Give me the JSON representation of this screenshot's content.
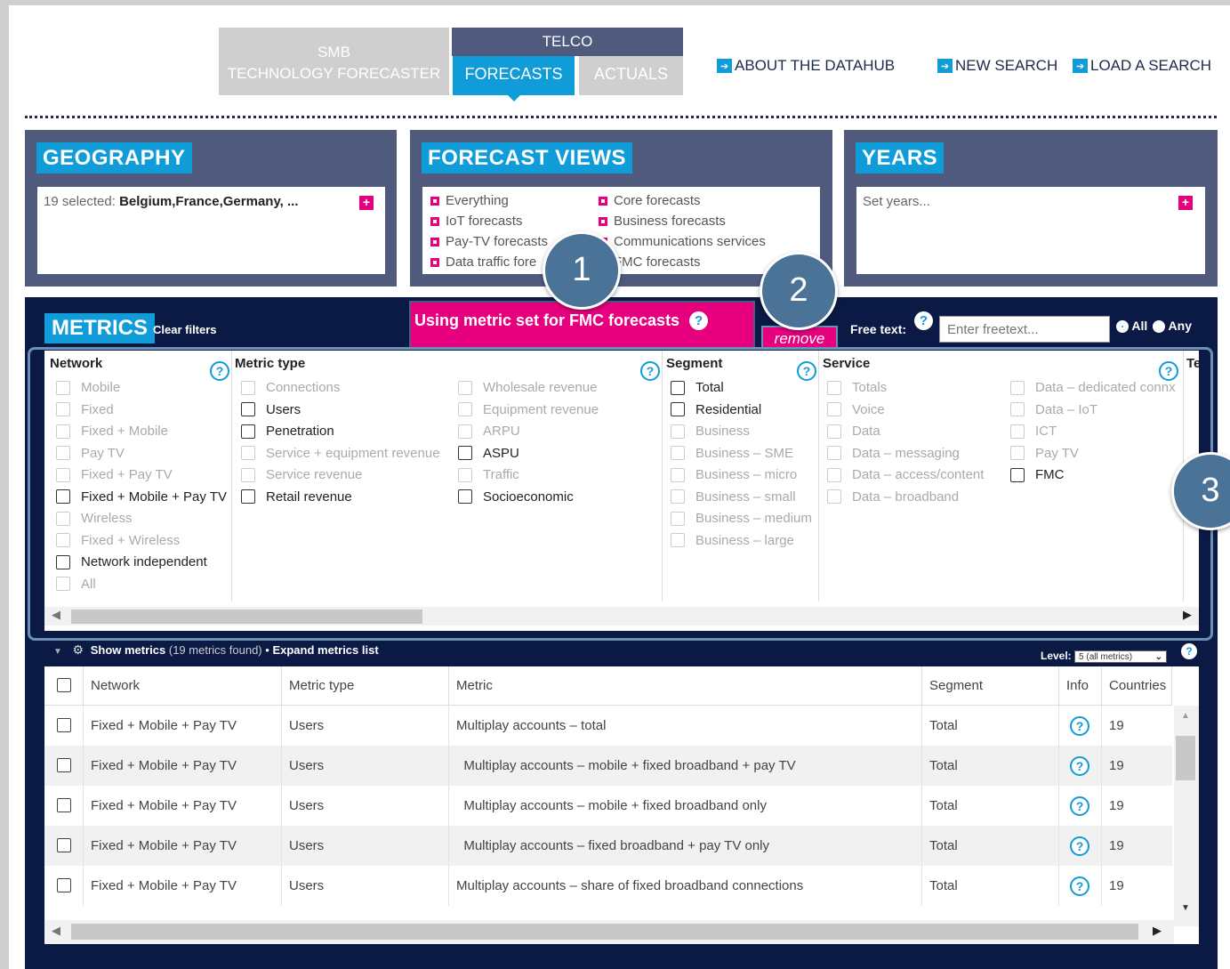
{
  "top_tabs": {
    "smb_line1": "SMB",
    "smb_line2": "TECHNOLOGY FORECASTER",
    "telco": "TELCO",
    "forecasts": "FORECASTS",
    "actuals": "ACTUALS"
  },
  "top_links": {
    "about": "ABOUT THE DATAHUB",
    "new_search": "NEW SEARCH",
    "load_search": "LOAD A SEARCH"
  },
  "geography": {
    "title": "GEOGRAPHY",
    "selected_prefix": "19 selected:",
    "selected_values": "Belgium,France,Germany, ..."
  },
  "forecast_views": {
    "title": "FORECAST VIEWS",
    "left": [
      "Everything",
      "IoT forecasts",
      "Pay-TV forecasts",
      "Data traffic fore"
    ],
    "right": [
      "Core forecasts",
      "Business forecasts",
      "Communications services",
      "FMC forecasts"
    ]
  },
  "years": {
    "title": "YEARS",
    "placeholder": "Set years..."
  },
  "metrics": {
    "title": "METRICS",
    "clear_filters": "Clear filters",
    "metric_set": "Using metric set for FMC forecasts",
    "remove": "remove",
    "free_text_label": "Free text:",
    "free_text_placeholder": "Enter freetext...",
    "radio_all": "All",
    "radio_any": "Any"
  },
  "filters": {
    "network": {
      "title": "Network",
      "items": [
        {
          "label": "Mobile",
          "active": false
        },
        {
          "label": "Fixed",
          "active": false
        },
        {
          "label": "Fixed + Mobile",
          "active": false
        },
        {
          "label": "Pay TV",
          "active": false
        },
        {
          "label": "Fixed + Pay TV",
          "active": false
        },
        {
          "label": "Fixed + Mobile + Pay TV",
          "active": true
        },
        {
          "label": "Wireless",
          "active": false
        },
        {
          "label": "Fixed + Wireless",
          "active": false
        },
        {
          "label": "Network independent",
          "active": true
        },
        {
          "label": "All",
          "active": false
        }
      ]
    },
    "metric_type": {
      "title": "Metric type",
      "col1": [
        {
          "label": "Connections",
          "active": false
        },
        {
          "label": "Users",
          "active": true
        },
        {
          "label": "Penetration",
          "active": true
        },
        {
          "label": "Service + equipment revenue",
          "active": false
        },
        {
          "label": "Service revenue",
          "active": false
        },
        {
          "label": "Retail revenue",
          "active": true
        }
      ],
      "col2": [
        {
          "label": "Wholesale revenue",
          "active": false
        },
        {
          "label": "Equipment revenue",
          "active": false
        },
        {
          "label": "ARPU",
          "active": false
        },
        {
          "label": "ASPU",
          "active": true
        },
        {
          "label": "Traffic",
          "active": false
        },
        {
          "label": "Socioeconomic",
          "active": true
        }
      ]
    },
    "segment": {
      "title": "Segment",
      "items": [
        {
          "label": "Total",
          "active": true
        },
        {
          "label": "Residential",
          "active": true
        },
        {
          "label": "Business",
          "active": false
        },
        {
          "label": "Business – SME",
          "active": false
        },
        {
          "label": "Business – micro",
          "active": false
        },
        {
          "label": "Business – small",
          "active": false
        },
        {
          "label": "Business – medium",
          "active": false
        },
        {
          "label": "Business – large",
          "active": false
        }
      ]
    },
    "service": {
      "title": "Service",
      "col1": [
        {
          "label": "Totals",
          "active": false
        },
        {
          "label": "Voice",
          "active": false
        },
        {
          "label": "Data",
          "active": false
        },
        {
          "label": "Data – messaging",
          "active": false
        },
        {
          "label": "Data – access/content",
          "active": false
        },
        {
          "label": "Data – broadband",
          "active": false
        }
      ],
      "col2": [
        {
          "label": "Data – dedicated connx",
          "active": false
        },
        {
          "label": "Data – IoT",
          "active": false
        },
        {
          "label": "ICT",
          "active": false
        },
        {
          "label": "Pay TV",
          "active": false
        },
        {
          "label": "FMC",
          "active": true
        }
      ]
    },
    "cut_title": "Te"
  },
  "callouts": [
    "1",
    "2",
    "3"
  ],
  "results": {
    "show_metrics": "Show metrics",
    "found": "(19 metrics found)",
    "bullet": "•",
    "expand": "Expand metrics list",
    "level_label": "Level:",
    "level_value": "5 (all metrics)",
    "columns": [
      "Network",
      "Metric type",
      "Metric",
      "Segment",
      "Info",
      "Countries"
    ],
    "rows": [
      {
        "network": "Fixed + Mobile + Pay TV",
        "metric_type": "Users",
        "metric": "Multiplay accounts – total",
        "segment": "Total",
        "countries": "19"
      },
      {
        "network": "Fixed + Mobile + Pay TV",
        "metric_type": "Users",
        "metric": "  Multiplay accounts – mobile + fixed broadband + pay TV",
        "segment": "Total",
        "countries": "19"
      },
      {
        "network": "Fixed + Mobile + Pay TV",
        "metric_type": "Users",
        "metric": "  Multiplay accounts – mobile + fixed broadband only",
        "segment": "Total",
        "countries": "19"
      },
      {
        "network": "Fixed + Mobile + Pay TV",
        "metric_type": "Users",
        "metric": "  Multiplay accounts – fixed broadband + pay TV only",
        "segment": "Total",
        "countries": "19"
      },
      {
        "network": "Fixed + Mobile + Pay TV",
        "metric_type": "Users",
        "metric": "Multiplay accounts – share of fixed broadband connections",
        "segment": "Total",
        "countries": "19"
      }
    ]
  },
  "colors": {
    "navy": "#0b1a45",
    "slate": "#4f5a7d",
    "blue": "#109bd9",
    "magenta": "#e6007e"
  }
}
